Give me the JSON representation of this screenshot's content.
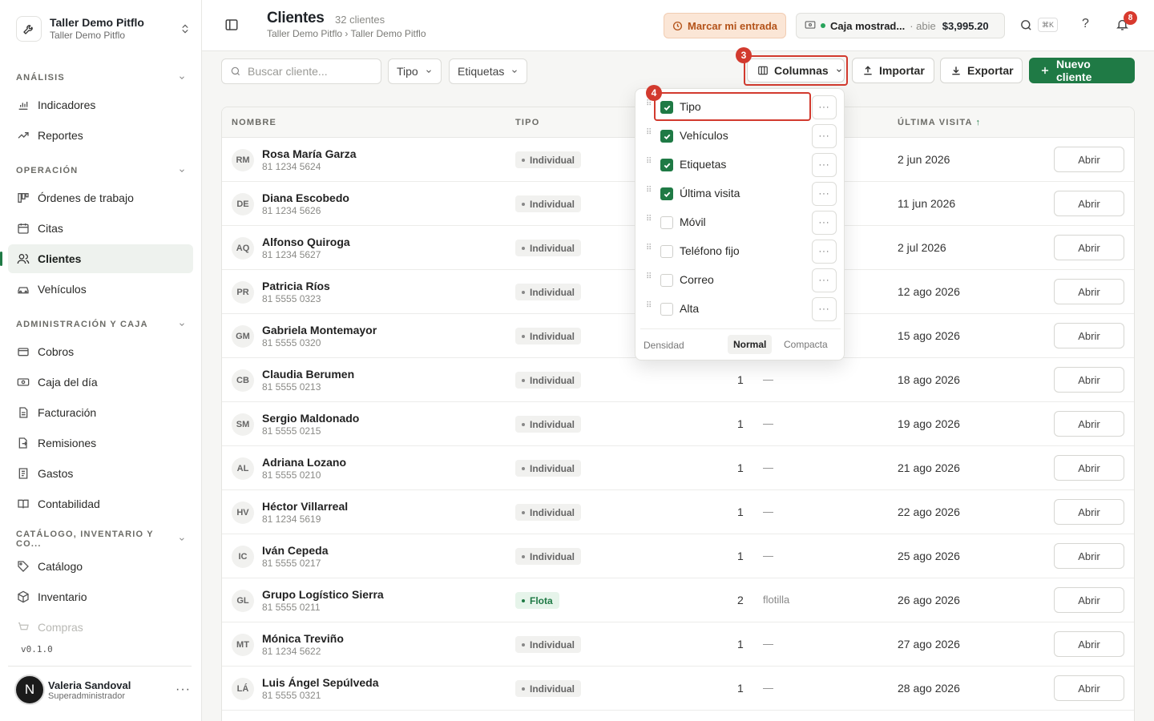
{
  "workspace": {
    "name": "Taller Demo Pitflo",
    "sub": "Taller Demo Pitflo"
  },
  "sidebar": {
    "sections": [
      {
        "label": "ANÁLISIS"
      },
      {
        "label": "OPERACIÓN"
      },
      {
        "label": "ADMINISTRACIÓN Y CAJA"
      },
      {
        "label": "CATÁLOGO, INVENTARIO Y CO..."
      }
    ],
    "items": [
      {
        "label": "Indicadores",
        "icon": "chart-bar-icon"
      },
      {
        "label": "Reportes",
        "icon": "trend-up-icon"
      },
      {
        "label": "Órdenes de trabajo",
        "icon": "kanban-icon"
      },
      {
        "label": "Citas",
        "icon": "calendar-icon"
      },
      {
        "label": "Clientes",
        "icon": "users-icon",
        "active": true
      },
      {
        "label": "Vehículos",
        "icon": "car-icon"
      },
      {
        "label": "Cobros",
        "icon": "wallet-icon"
      },
      {
        "label": "Caja del día",
        "icon": "cash-icon"
      },
      {
        "label": "Facturación",
        "icon": "invoice-icon"
      },
      {
        "label": "Remisiones",
        "icon": "file-arrow-icon"
      },
      {
        "label": "Gastos",
        "icon": "receipt-icon"
      },
      {
        "label": "Contabilidad",
        "icon": "book-icon"
      },
      {
        "label": "Catálogo",
        "icon": "tag-icon"
      },
      {
        "label": "Inventario",
        "icon": "box-icon"
      },
      {
        "label": "Compras",
        "icon": "cart-icon"
      }
    ],
    "version": "v0.1.0",
    "user": {
      "initial": "N",
      "name": "Valeria Sandoval",
      "role": "Superadministrador"
    }
  },
  "header": {
    "title": "Clientes",
    "count": "32 clientes",
    "breadcrumb": "Taller Demo Pitflo › Taller Demo Pitflo",
    "entrada_label": "Marcar mi entrada",
    "caja": {
      "name": "Caja mostrad...",
      "status": "abie",
      "amount": "$3,995.20"
    },
    "kbd": "⌘K",
    "help": "?",
    "notifications": "8"
  },
  "toolbar": {
    "search_placeholder": "Buscar cliente...",
    "filter_tipo": "Tipo",
    "filter_etiquetas": "Etiquetas",
    "columnas": "Columnas",
    "importar": "Importar",
    "exportar": "Exportar",
    "nuevo": "Nuevo cliente",
    "step3": "3",
    "step4": "4"
  },
  "table": {
    "headers": {
      "nombre": "NOMBRE",
      "tipo": "TIPO",
      "ultima": "ÚLTIMA VISITA"
    },
    "open_label": "Abrir",
    "rows": [
      {
        "initials": "RM",
        "name": "Rosa María Garza",
        "phone": "81 1234 5624",
        "tipo": "Individual",
        "veh": "",
        "eti": "",
        "visita": "2 jun 2026"
      },
      {
        "initials": "DE",
        "name": "Diana Escobedo",
        "phone": "81 1234 5626",
        "tipo": "Individual",
        "veh": "",
        "eti": "",
        "visita": "11 jun 2026"
      },
      {
        "initials": "AQ",
        "name": "Alfonso Quiroga",
        "phone": "81 1234 5627",
        "tipo": "Individual",
        "veh": "",
        "eti": "",
        "visita": "2 jul 2026"
      },
      {
        "initials": "PR",
        "name": "Patricia Ríos",
        "phone": "81 5555 0323",
        "tipo": "Individual",
        "veh": "",
        "eti": "",
        "visita": "12 ago 2026"
      },
      {
        "initials": "GM",
        "name": "Gabriela Montemayor",
        "phone": "81 5555 0320",
        "tipo": "Individual",
        "veh": "",
        "eti": "",
        "visita": "15 ago 2026"
      },
      {
        "initials": "CB",
        "name": "Claudia Berumen",
        "phone": "81 5555 0213",
        "tipo": "Individual",
        "veh": "1",
        "eti": "—",
        "visita": "18 ago 2026"
      },
      {
        "initials": "SM",
        "name": "Sergio Maldonado",
        "phone": "81 5555 0215",
        "tipo": "Individual",
        "veh": "1",
        "eti": "—",
        "visita": "19 ago 2026"
      },
      {
        "initials": "AL",
        "name": "Adriana Lozano",
        "phone": "81 5555 0210",
        "tipo": "Individual",
        "veh": "1",
        "eti": "—",
        "visita": "21 ago 2026"
      },
      {
        "initials": "HV",
        "name": "Héctor Villarreal",
        "phone": "81 1234 5619",
        "tipo": "Individual",
        "veh": "1",
        "eti": "—",
        "visita": "22 ago 2026"
      },
      {
        "initials": "IC",
        "name": "Iván Cepeda",
        "phone": "81 5555 0217",
        "tipo": "Individual",
        "veh": "1",
        "eti": "—",
        "visita": "25 ago 2026"
      },
      {
        "initials": "GL",
        "name": "Grupo Logístico Sierra",
        "phone": "81 5555 0211",
        "tipo": "Flota",
        "veh": "2",
        "eti": "flotilla",
        "visita": "26 ago 2026"
      },
      {
        "initials": "MT",
        "name": "Mónica Treviño",
        "phone": "81 1234 5622",
        "tipo": "Individual",
        "veh": "1",
        "eti": "—",
        "visita": "27 ago 2026"
      },
      {
        "initials": "LÁ",
        "name": "Luis Ángel Sepúlveda",
        "phone": "81 5555 0321",
        "tipo": "Individual",
        "veh": "1",
        "eti": "—",
        "visita": "28 ago 2026"
      }
    ]
  },
  "columns_menu": {
    "items": [
      {
        "label": "Tipo",
        "checked": true
      },
      {
        "label": "Vehículos",
        "checked": true
      },
      {
        "label": "Etiquetas",
        "checked": true
      },
      {
        "label": "Última visita",
        "checked": true
      },
      {
        "label": "Móvil",
        "checked": false
      },
      {
        "label": "Teléfono fijo",
        "checked": false
      },
      {
        "label": "Correo",
        "checked": false
      },
      {
        "label": "Alta",
        "checked": false
      }
    ],
    "density_label": "Densidad",
    "density_normal": "Normal",
    "density_compact": "Compacta"
  },
  "colors": {
    "accent": "#1f7a45",
    "highlight": "#d23a2e",
    "entrada_bg": "#fbe6d6"
  }
}
